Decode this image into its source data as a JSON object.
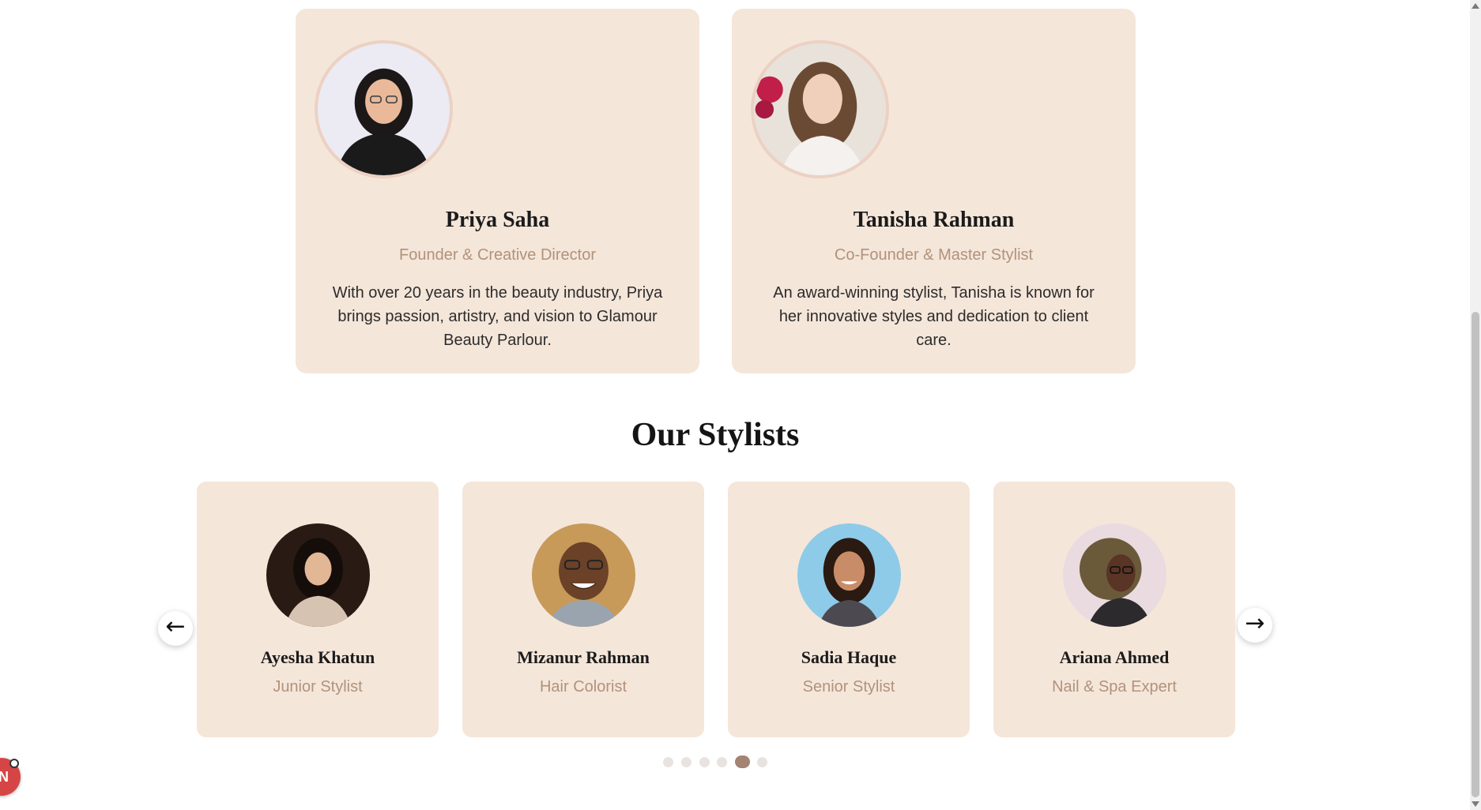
{
  "leaders": [
    {
      "name": "Priya Saha",
      "role": "Founder & Creative Director",
      "bio": "With over 20 years in the beauty industry, Priya brings passion, artistry, and vision to Glamour Beauty Parlour."
    },
    {
      "name": "Tanisha Rahman",
      "role": "Co-Founder & Master Stylist",
      "bio": "An award-winning stylist, Tanisha is known for her innovative styles and dedication to client care."
    }
  ],
  "stylists_section": {
    "title": "Our Stylists",
    "prev_arrow": "←",
    "next_arrow": "→",
    "stylists": [
      {
        "name": "Ayesha Khatun",
        "role": "Junior Stylist"
      },
      {
        "name": "Mizanur Rahman",
        "role": "Hair Colorist"
      },
      {
        "name": "Sadia Haque",
        "role": "Senior Stylist"
      },
      {
        "name": "Ariana Ahmed",
        "role": "Nail & Spa Expert"
      }
    ],
    "pagination": {
      "total": 6,
      "active_index": 4
    }
  },
  "widget": {
    "glyph": "N"
  },
  "colors": {
    "card_background": "#f5e6da",
    "role_text": "#b0937a",
    "active_dot": "#a38371",
    "widget": "#d64545"
  }
}
